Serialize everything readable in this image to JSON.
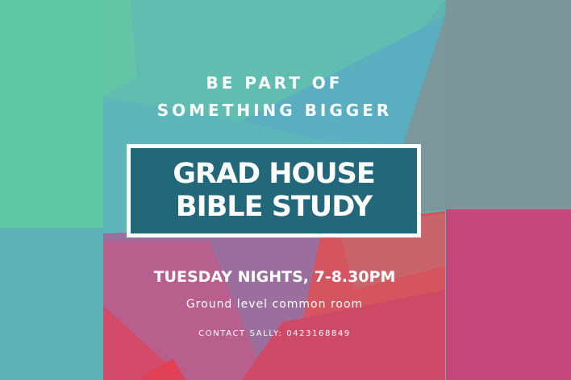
{
  "flyer": {
    "tagline_line1": "BE PART OF",
    "tagline_line2": "SOMETHING BIGGER",
    "title_line1": "GRAD HOUSE",
    "title_line2": "BIBLE STUDY",
    "schedule": "TUESDAY NIGHTS, 7-8.30PM",
    "location": "Ground level common room",
    "contact": "CONTACT SALLY: 0423168849"
  },
  "colors": {
    "title_box": "#22677a",
    "teal": "#5fb3b3",
    "mint": "#5ec8a3",
    "slate": "#7a969a",
    "magenta": "#c6487a",
    "coral": "#d4555f",
    "violet": "#9a6f9e"
  }
}
